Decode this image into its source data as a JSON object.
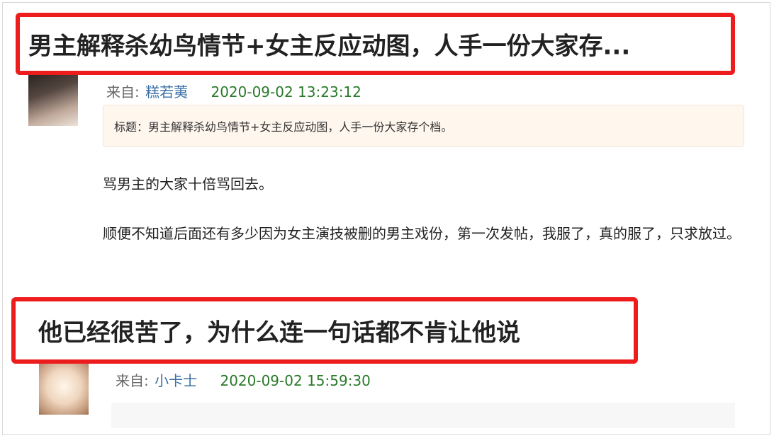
{
  "post1": {
    "headline": "男主解释杀幼鸟情节+女主反应动图，人手一份大家存...",
    "from_label": "来自:",
    "author": "糕若荑",
    "timestamp": "2020-09-02 13:23:12",
    "title_box": "标题：男主解释杀幼鸟情节+女主反应动图，人手一份大家存个档。",
    "paragraphs": [
      "骂男主的大家十倍骂回去。",
      "顺便不知道后面还有多少因为女主演技被删的男主戏份，第一次发帖，我服了，真的服了，只求放过。"
    ]
  },
  "post2": {
    "headline": "他已经很苦了，为什么连一句话都不肯让他说",
    "from_label": "来自:",
    "author": "小卡士",
    "timestamp": "2020-09-02 15:59:30"
  },
  "colors": {
    "highlight_border": "#ee1d1d",
    "author_link": "#3a6ea5",
    "timestamp": "#2a7a2a",
    "title_box_bg": "#fff6ee"
  }
}
